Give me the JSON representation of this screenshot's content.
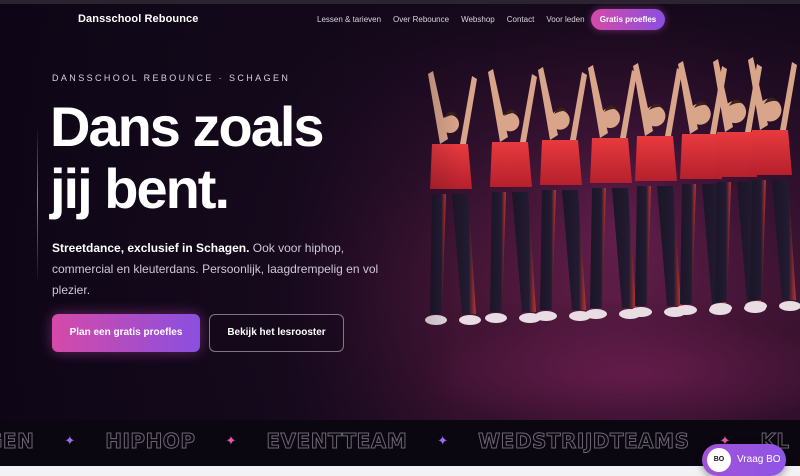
{
  "nav": {
    "brand": "Dansschool Rebounce",
    "links": [
      "Lessen & tarieven",
      "Over Rebounce",
      "Webshop",
      "Contact",
      "Voor leden"
    ],
    "cta": "Gratis proefles"
  },
  "hero": {
    "eyebrow": "DANSSCHOOL REBOUNCE · SCHAGEN",
    "headline_line1": "Dans zoals",
    "headline_line2": "jij bent.",
    "lead_strong": "Streetdance, exclusief in Schagen.",
    "lead_rest": " Ook voor hiphop, commercial en kleuterdans. Persoonlijk, laagdrempelig en vol plezier.",
    "primary_button": "Plan een gratis proefles",
    "secondary_button": "Bekijk het lesrooster"
  },
  "marquee": {
    "items": [
      "GEN",
      "HIPHOP",
      "EVENTTEAM",
      "WEDSTRIJDTEAMS",
      "KL"
    ]
  },
  "chat": {
    "avatar": "BO",
    "label": "Vraag BO"
  },
  "colors": {
    "accent_pink": "#d54aa8",
    "accent_purple": "#8a4fe0",
    "background": "#0c0712"
  }
}
